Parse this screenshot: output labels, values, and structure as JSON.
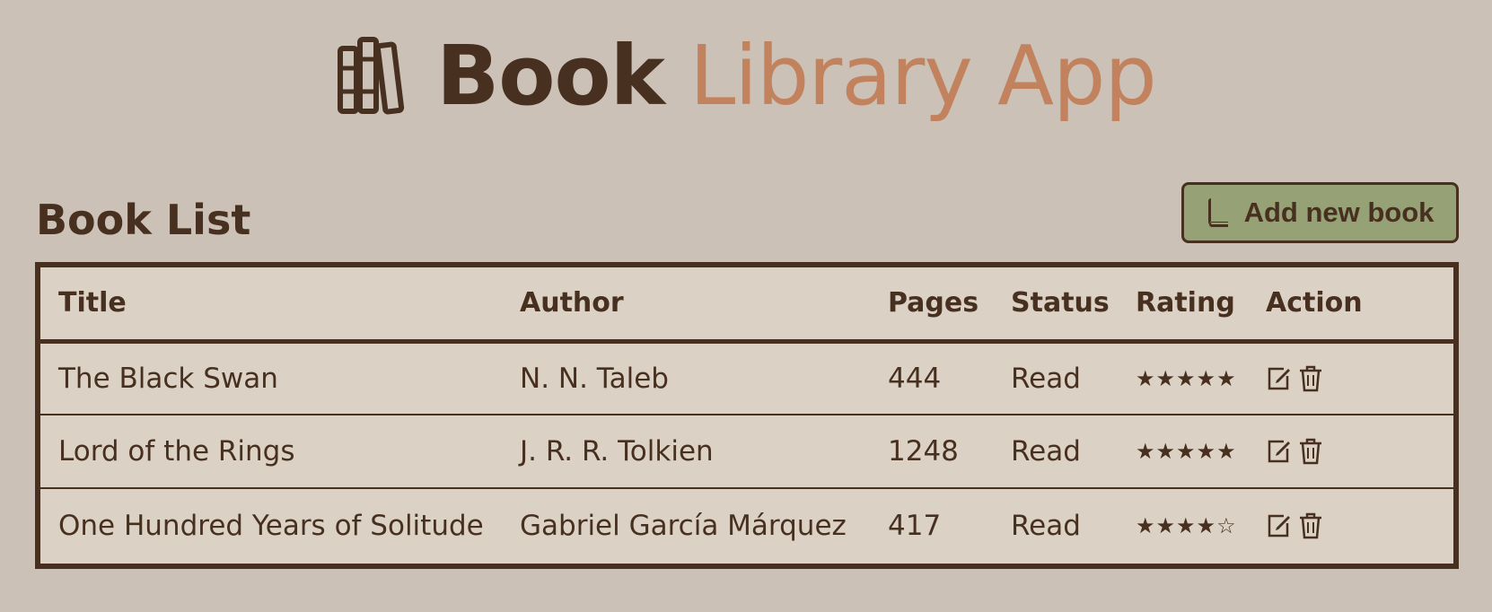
{
  "header": {
    "title_strong": "Book",
    "title_light": "Library App",
    "logo_icon": "books-icon"
  },
  "list": {
    "title": "Book List",
    "add_button_label": "Add new book",
    "add_button_icon": "book-icon"
  },
  "table": {
    "columns": [
      "Title",
      "Author",
      "Pages",
      "Status",
      "Rating",
      "Action"
    ],
    "rows": [
      {
        "title": "The Black Swan",
        "author": "N. N. Taleb",
        "pages": "444",
        "status": "Read",
        "rating": "★★★★★"
      },
      {
        "title": "Lord of the Rings",
        "author": "J. R. R. Tolkien",
        "pages": "1248",
        "status": "Read",
        "rating": "★★★★★"
      },
      {
        "title": "One Hundred Years of Solitude",
        "author": "Gabriel García Márquez",
        "pages": "417",
        "status": "Read",
        "rating": "★★★★☆"
      }
    ]
  },
  "colors": {
    "background": "#cbc1b7",
    "dark_brown": "#47301f",
    "accent": "#c2825d",
    "button_green": "#96a176",
    "table_bg": "#dbd1c5"
  }
}
